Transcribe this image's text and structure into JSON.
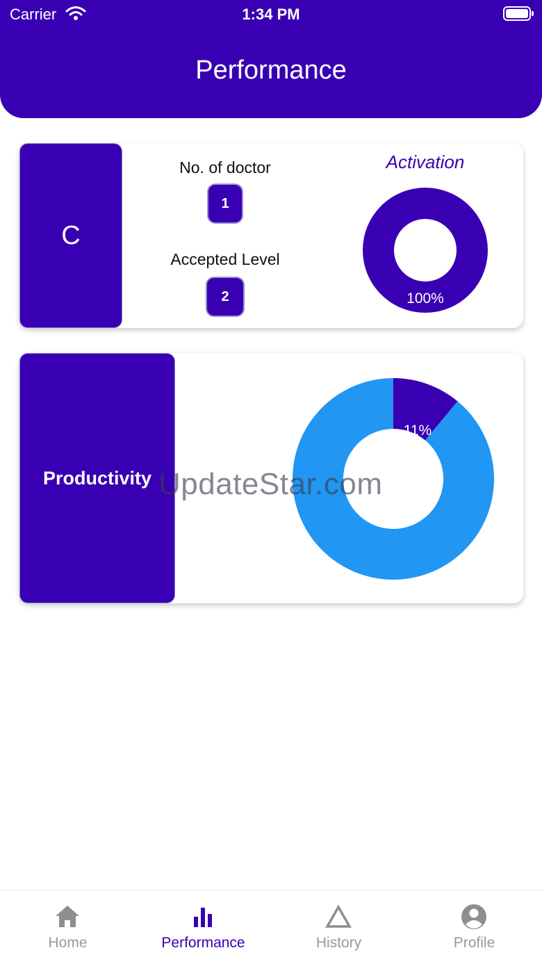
{
  "status_bar": {
    "carrier": "Carrier",
    "time": "1:34 PM"
  },
  "header": {
    "title": "Performance"
  },
  "summary_card": {
    "grade": "C",
    "doctors_label": "No. of doctor",
    "doctors_value": "1",
    "level_label": "Accepted Level",
    "level_value": "2",
    "activation_title": "Activation",
    "activation_label": "100%",
    "activation_fraction": 1.0
  },
  "productivity_card": {
    "label": "Productivity",
    "percent_label": "11%",
    "fraction": 0.11
  },
  "watermark": "UpdateStar.com",
  "colors": {
    "brand": "#3900b3",
    "secondary": "#2196f3",
    "inactive": "#9a9a9a"
  },
  "tabs": [
    {
      "label": "Home",
      "icon": "home-icon",
      "active": false
    },
    {
      "label": "Performance",
      "icon": "bar-chart-icon",
      "active": true
    },
    {
      "label": "History",
      "icon": "triangle-icon",
      "active": false
    },
    {
      "label": "Profile",
      "icon": "profile-icon",
      "active": false
    }
  ]
}
